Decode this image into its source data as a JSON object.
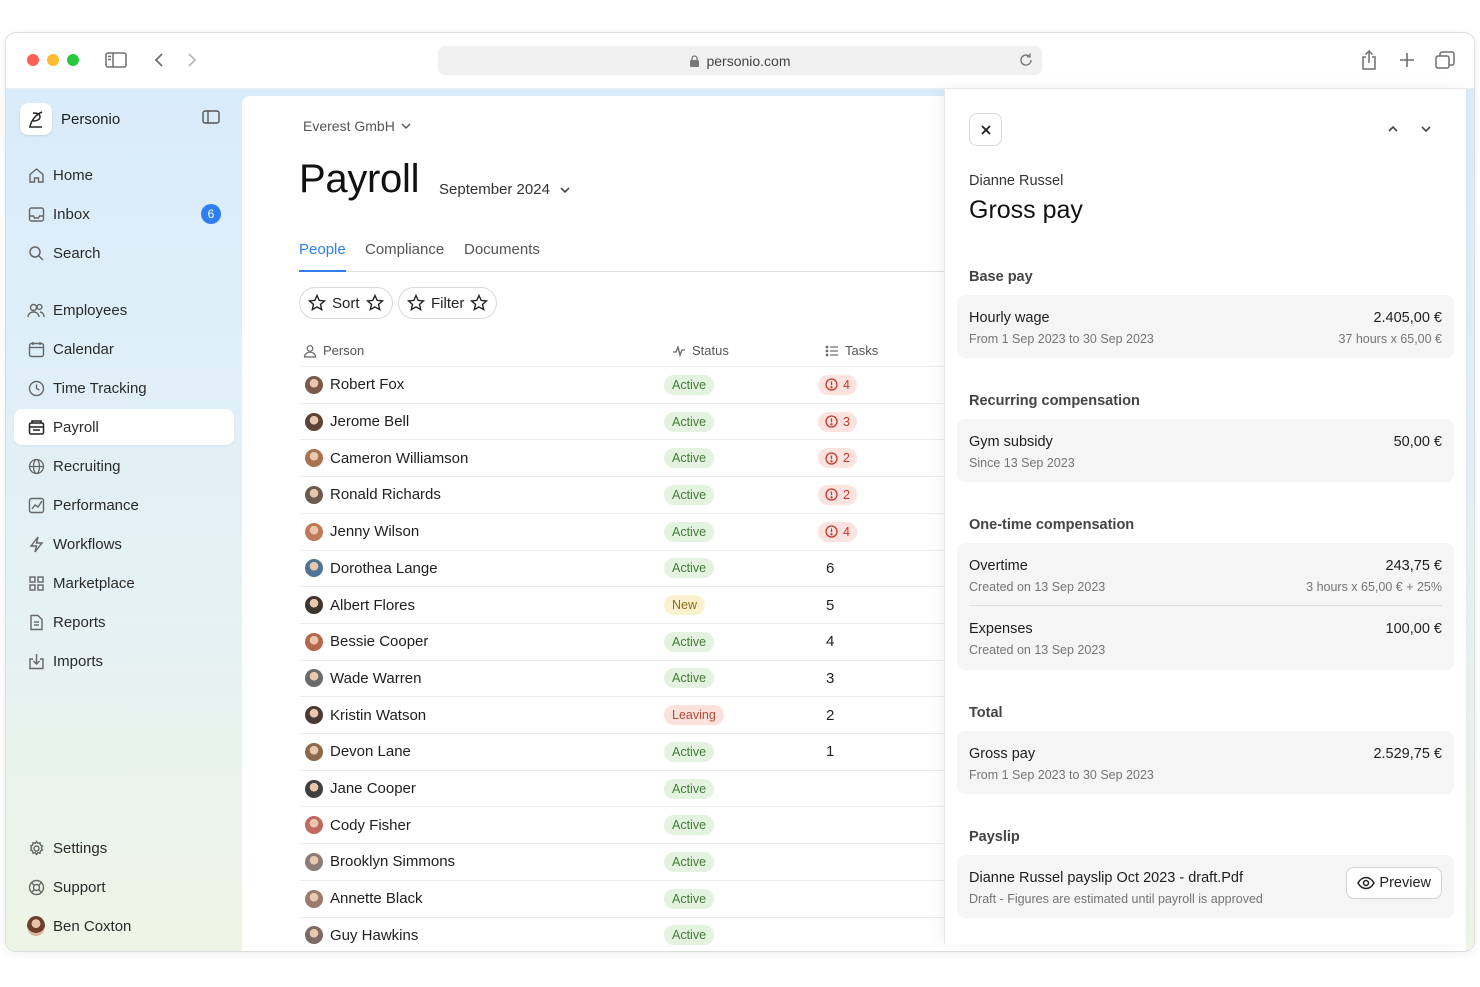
{
  "browser": {
    "url": "personio.com"
  },
  "sidebar": {
    "brand": "Personio",
    "items": [
      {
        "label": "Home",
        "icon": "home-icon"
      },
      {
        "label": "Inbox",
        "icon": "inbox-icon",
        "badge": "6"
      },
      {
        "label": "Search",
        "icon": "search-icon"
      },
      {
        "label": "Employees",
        "icon": "users-icon"
      },
      {
        "label": "Calendar",
        "icon": "calendar-icon"
      },
      {
        "label": "Time Tracking",
        "icon": "clock-icon"
      },
      {
        "label": "Payroll",
        "icon": "payroll-icon",
        "active": true
      },
      {
        "label": "Recruiting",
        "icon": "globe-icon"
      },
      {
        "label": "Performance",
        "icon": "chart-icon"
      },
      {
        "label": "Workflows",
        "icon": "bolt-icon"
      },
      {
        "label": "Marketplace",
        "icon": "grid-icon"
      },
      {
        "label": "Reports",
        "icon": "report-icon"
      },
      {
        "label": "Imports",
        "icon": "import-icon"
      }
    ],
    "bottom": [
      {
        "label": "Settings",
        "icon": "gear-icon"
      },
      {
        "label": "Support",
        "icon": "lifebuoy-icon"
      },
      {
        "label": "Ben Coxton",
        "icon": "avatar"
      }
    ]
  },
  "main": {
    "company": "Everest GmbH",
    "title": "Payroll",
    "period": "September 2024",
    "tabs": [
      "People",
      "Compliance",
      "Documents"
    ],
    "sort_label": "Sort",
    "filter_label": "Filter",
    "columns": {
      "person": "Person",
      "status": "Status",
      "tasks": "Tasks"
    },
    "rows": [
      {
        "name": "Robert Fox",
        "status": "Active",
        "tasks": "4",
        "warn": true
      },
      {
        "name": "Jerome Bell",
        "status": "Active",
        "tasks": "3",
        "warn": true
      },
      {
        "name": "Cameron Williamson",
        "status": "Active",
        "tasks": "2",
        "warn": true
      },
      {
        "name": "Ronald Richards",
        "status": "Active",
        "tasks": "2",
        "warn": true
      },
      {
        "name": "Jenny Wilson",
        "status": "Active",
        "tasks": "4",
        "warn": true
      },
      {
        "name": "Dorothea Lange",
        "status": "Active",
        "tasks": "6",
        "warn": false
      },
      {
        "name": "Albert Flores",
        "status": "New",
        "tasks": "5",
        "warn": false
      },
      {
        "name": "Bessie Cooper",
        "status": "Active",
        "tasks": "4",
        "warn": false
      },
      {
        "name": "Wade Warren",
        "status": "Active",
        "tasks": "3",
        "warn": false
      },
      {
        "name": "Kristin Watson",
        "status": "Leaving",
        "tasks": "2",
        "warn": false
      },
      {
        "name": "Devon Lane",
        "status": "Active",
        "tasks": "1",
        "warn": false
      },
      {
        "name": "Jane Cooper",
        "status": "Active",
        "tasks": "",
        "warn": false
      },
      {
        "name": "Cody Fisher",
        "status": "Active",
        "tasks": "",
        "warn": false
      },
      {
        "name": "Brooklyn Simmons",
        "status": "Active",
        "tasks": "",
        "warn": false
      },
      {
        "name": "Annette Black",
        "status": "Active",
        "tasks": "",
        "warn": false
      },
      {
        "name": "Guy Hawkins",
        "status": "Active",
        "tasks": "",
        "warn": false
      }
    ]
  },
  "panel": {
    "employee": "Dianne Russel",
    "title": "Gross pay",
    "base_pay": {
      "heading": "Base pay",
      "label": "Hourly wage",
      "amount": "2.405,00 €",
      "detail": "From 1 Sep 2023 to 30 Sep 2023",
      "calc": "37 hours x 65,00 €"
    },
    "recurring": {
      "heading": "Recurring compensation",
      "label": "Gym subsidy",
      "amount": "50,00 €",
      "detail": "Since 13 Sep 2023"
    },
    "one_time": {
      "heading": "One-time compensation",
      "items": [
        {
          "label": "Overtime",
          "amount": "243,75 €",
          "detail": "Created on 13 Sep 2023",
          "calc": "3 hours x 65,00 € + 25%"
        },
        {
          "label": "Expenses",
          "amount": "100,00 €",
          "detail": "Created on 13 Sep 2023",
          "calc": ""
        }
      ]
    },
    "total": {
      "heading": "Total",
      "label": "Gross pay",
      "amount": "2.529,75 €",
      "detail": "From 1 Sep 2023 to 30 Sep 2023"
    },
    "payslip": {
      "heading": "Payslip",
      "file": "Dianne Russel payslip Oct 2023 - draft.Pdf",
      "note": "Draft - Figures are estimated until payroll is approved",
      "preview_label": "Preview"
    }
  }
}
